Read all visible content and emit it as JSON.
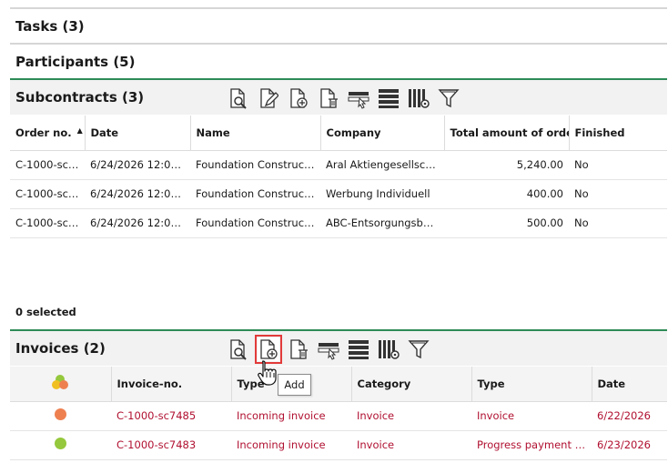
{
  "sections": {
    "tasks": "Tasks (3)",
    "participants": "Participants (5)",
    "subcontracts": "Subcontracts (3)",
    "invoices": "Invoices (2)"
  },
  "toolbar_icons": [
    "view-details-icon",
    "edit-icon",
    "add-icon",
    "delete-icon",
    "select-icon",
    "list-view-icon",
    "column-settings-icon",
    "filter-icon"
  ],
  "subcontracts": {
    "columns": [
      "Order no.",
      "Date",
      "Name",
      "Company",
      "Total amount of order",
      "Finished"
    ],
    "rows": [
      [
        "C-1000-sc7...",
        "6/24/2026 12:00 AM",
        "Foundation Constructio...",
        "Aral Aktiengesellschaft",
        "5,240.00",
        "No"
      ],
      [
        "C-1000-sc7...",
        "6/24/2026 12:00 AM",
        "Foundation Construction",
        "Werbung Individuell",
        "400.00",
        "No"
      ],
      [
        "C-1000-sc7...",
        "6/24/2026 12:00 AM",
        "Foundation Constructio...",
        "ABC-Entsorgungsbetr...",
        "500.00",
        "No"
      ]
    ],
    "selected_text": "0 selected"
  },
  "invoices": {
    "columns": [
      "",
      "Invoice-no.",
      "Type",
      "Category",
      "Type",
      "Date"
    ],
    "rows": [
      {
        "status_color": "#ee8050",
        "cells": [
          "C-1000-sc7485",
          "Incoming invoice",
          "Invoice",
          "Invoice",
          "6/22/2026"
        ]
      },
      {
        "status_color": "#95c83c",
        "cells": [
          "C-1000-sc7483",
          "Incoming invoice",
          "Invoice",
          "Progress payment inv...",
          "6/23/2026"
        ]
      }
    ]
  },
  "tooltip": "Add",
  "colors": {
    "accent_green": "#2e8b57",
    "link_red": "#b01030",
    "highlight": "#e23a3a"
  }
}
